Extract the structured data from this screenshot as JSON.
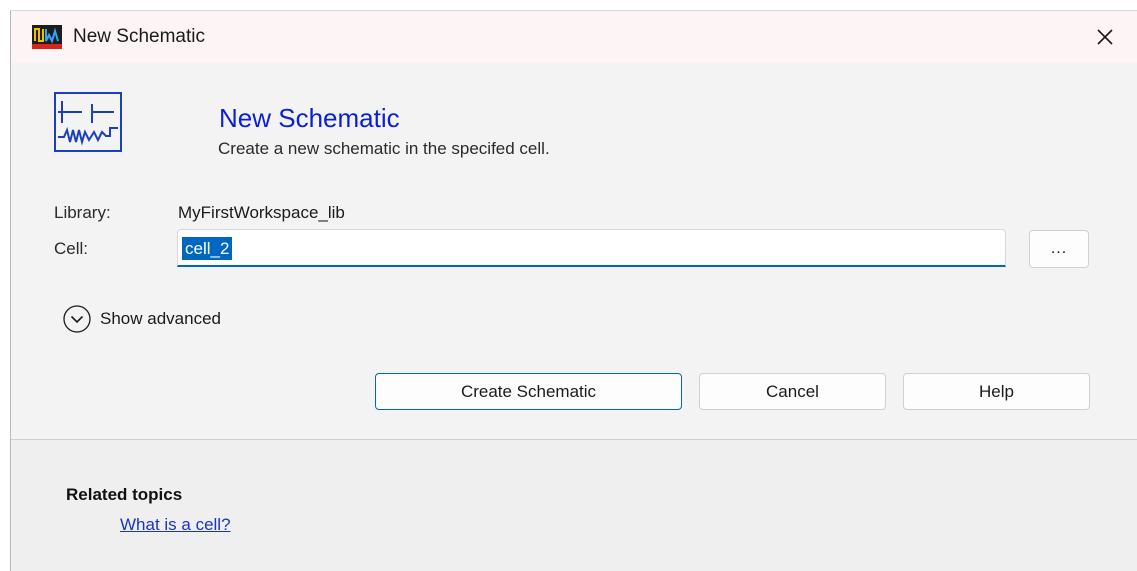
{
  "window": {
    "title": "New Schematic"
  },
  "header": {
    "title": "New Schematic",
    "description": "Create a new schematic in the specifed cell."
  },
  "form": {
    "library_label": "Library:",
    "library_value": "MyFirstWorkspace_lib",
    "cell_label": "Cell:",
    "cell_value": "cell_2",
    "browse_label": "..."
  },
  "advanced": {
    "label": "Show advanced"
  },
  "buttons": {
    "create": "Create Schematic",
    "cancel": "Cancel",
    "help": "Help"
  },
  "related": {
    "title": "Related topics",
    "link": "What is a cell?"
  },
  "icons": {
    "app": "schematic-app-icon",
    "close": "close-icon",
    "header": "schematic-icon",
    "expand": "chevron-down-circle-icon"
  },
  "colors": {
    "accent": "#0067c0",
    "header_title": "#0a1fd6",
    "link": "#1a35c4",
    "app_icon_red": "#d8241c"
  }
}
